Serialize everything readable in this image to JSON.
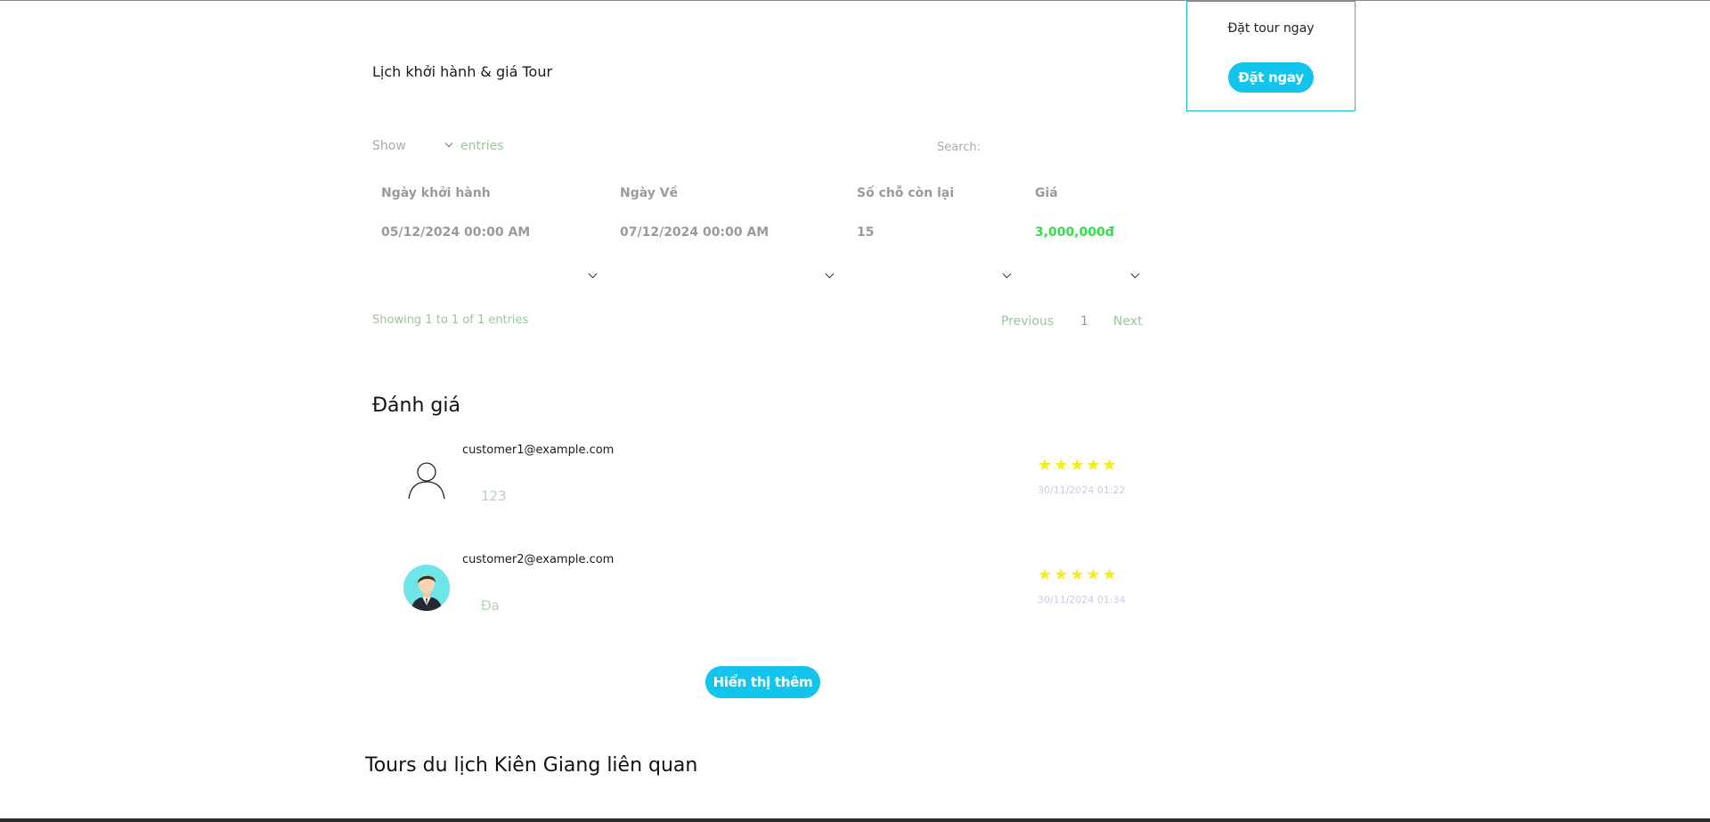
{
  "booking": {
    "text": "Đặt tour ngay",
    "button_label": "Đặt ngay"
  },
  "schedule": {
    "title": "Lịch khởi hành & giá Tour",
    "show_label": "Show",
    "entries_label": "entries",
    "search_label": "Search:",
    "columns": [
      "Ngày khởi hành",
      "Ngày Về",
      "Số chỗ còn lại",
      "Giá"
    ],
    "rows": [
      {
        "depart": "05/12/2024 00:00 AM",
        "return": "07/12/2024 00:00 AM",
        "seats": "15",
        "price": "3,000,000đ"
      }
    ],
    "info": "Showing 1 to 1 of 1 entries",
    "pagination": {
      "previous": "Previous",
      "page": "1",
      "next": "Next"
    },
    "price_color": "#2fe04a"
  },
  "reviews": {
    "title": "Đánh giá",
    "items": [
      {
        "email": "customer1@example.com",
        "text": "123",
        "date": "30/11/2024 01:22",
        "rating": 5,
        "stars": "★★★★★",
        "avatar": "user-outline-icon"
      },
      {
        "email": "customer2@example.com",
        "text": "Đa",
        "date": "30/11/2024 01:34",
        "rating": 5,
        "stars": "★★★★★",
        "avatar": "user-photo-avatar"
      }
    ],
    "more_button": "Hiển thị thêm",
    "star_color": "#f2ee1b"
  },
  "related": {
    "title": "Tours du lịch Kiên Giang liên quan"
  },
  "colors": {
    "accent": "#13c4ec"
  }
}
